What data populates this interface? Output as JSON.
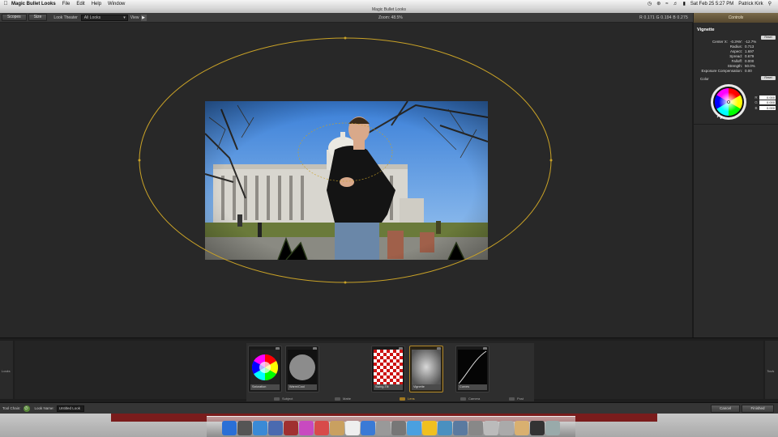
{
  "menubar": {
    "app_name": "Magic Bullet Looks",
    "items": [
      "File",
      "Edit",
      "Help",
      "Window"
    ],
    "clock": "Sat Feb 25  5:27 PM",
    "user": "Patrick Kirk"
  },
  "window": {
    "title": "Magic Bullet Looks"
  },
  "toolbar": {
    "scopes_label": "Scopes",
    "size_label": "Size",
    "look_theater_label": "Look Theater",
    "looks_select_value": "All Looks",
    "view_label": "View",
    "zoom_text": "Zoom: 48.5%",
    "rgb_readout": "R 0.171   G 0.194   B 0.275"
  },
  "right_panel": {
    "header": "Controls",
    "section_title": "Vignette",
    "reset_label": "Reset",
    "params": [
      {
        "key": "Center X:",
        "value": "-0.3%",
        "key2": "Y:",
        "value2": "-12.7%"
      },
      {
        "key": "Radius:",
        "value": "0.713"
      },
      {
        "key": "Aspect:",
        "value": "1.697"
      },
      {
        "key": "Spread:",
        "value": "0.679"
      },
      {
        "key": "Falloff:",
        "value": "0.000"
      },
      {
        "key": "Strength:",
        "value": "50.0%"
      },
      {
        "key": "Exposure Compensation:",
        "value": "0.00"
      }
    ],
    "color_label": "Color",
    "color_reset_label": "Reset",
    "rgb": [
      {
        "label": "R",
        "value": "0.000"
      },
      {
        "label": "G",
        "value": "0.000"
      },
      {
        "label": "B",
        "value": "0.000"
      }
    ]
  },
  "tool_chain": {
    "left_tab": "Looks",
    "right_tab": "Tools",
    "tools": [
      {
        "label": "Saturation"
      },
      {
        "label": "Warm/Cool"
      },
      {
        "label": "Swing-Tilt"
      },
      {
        "label": "Vignette"
      },
      {
        "label": "Curves"
      }
    ],
    "categories": [
      {
        "label": "Subject"
      },
      {
        "label": "Matte"
      },
      {
        "label": "Lens"
      },
      {
        "label": "Camera"
      },
      {
        "label": "Post"
      }
    ]
  },
  "statusbar": {
    "tool_chain_label": "Tool Chain:",
    "look_name_label": "Look Name:",
    "look_name_value": "Untitled Look",
    "cancel_label": "Cancel",
    "finished_label": "Finished"
  },
  "colors": {
    "accent_gold": "#c9a227",
    "panel_dark": "#282828",
    "controls_header": "#6b5a3c"
  }
}
